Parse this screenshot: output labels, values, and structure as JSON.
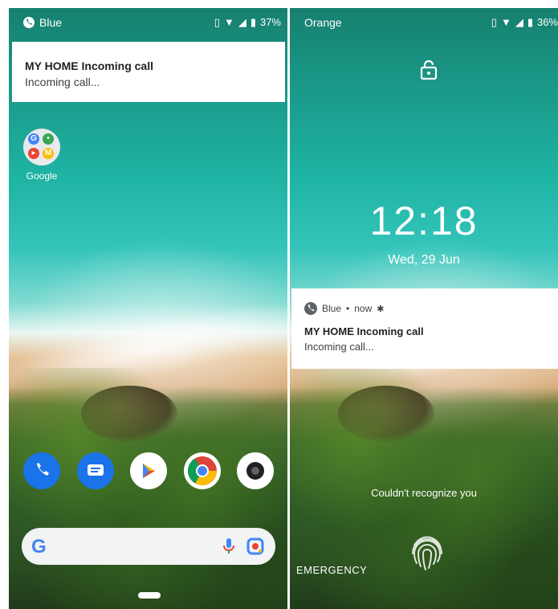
{
  "left": {
    "status": {
      "carrier": "Blue",
      "battery": "37%"
    },
    "notification": {
      "title": "MY HOME Incoming call",
      "body": "Incoming call..."
    },
    "app": {
      "label": "Google"
    },
    "dock": [
      "phone-icon",
      "messages-icon",
      "play-store-icon",
      "chrome-icon",
      "camera-icon"
    ],
    "search": {
      "logo": "G"
    }
  },
  "right": {
    "status": {
      "carrier": "Orange",
      "battery": "36%"
    },
    "clock": "12:18",
    "date": "Wed, 29 Jun",
    "notification": {
      "app": "Blue",
      "time": "now",
      "title": "MY HOME Incoming call",
      "body": "Incoming call..."
    },
    "unlock_message": "Couldn't recognize you",
    "emergency": "EMERGENCY"
  },
  "colors": {
    "phone": "#1a73e8",
    "messages": "#1a73e8",
    "camera": "#202124",
    "notif_bg": "#ffffff"
  }
}
